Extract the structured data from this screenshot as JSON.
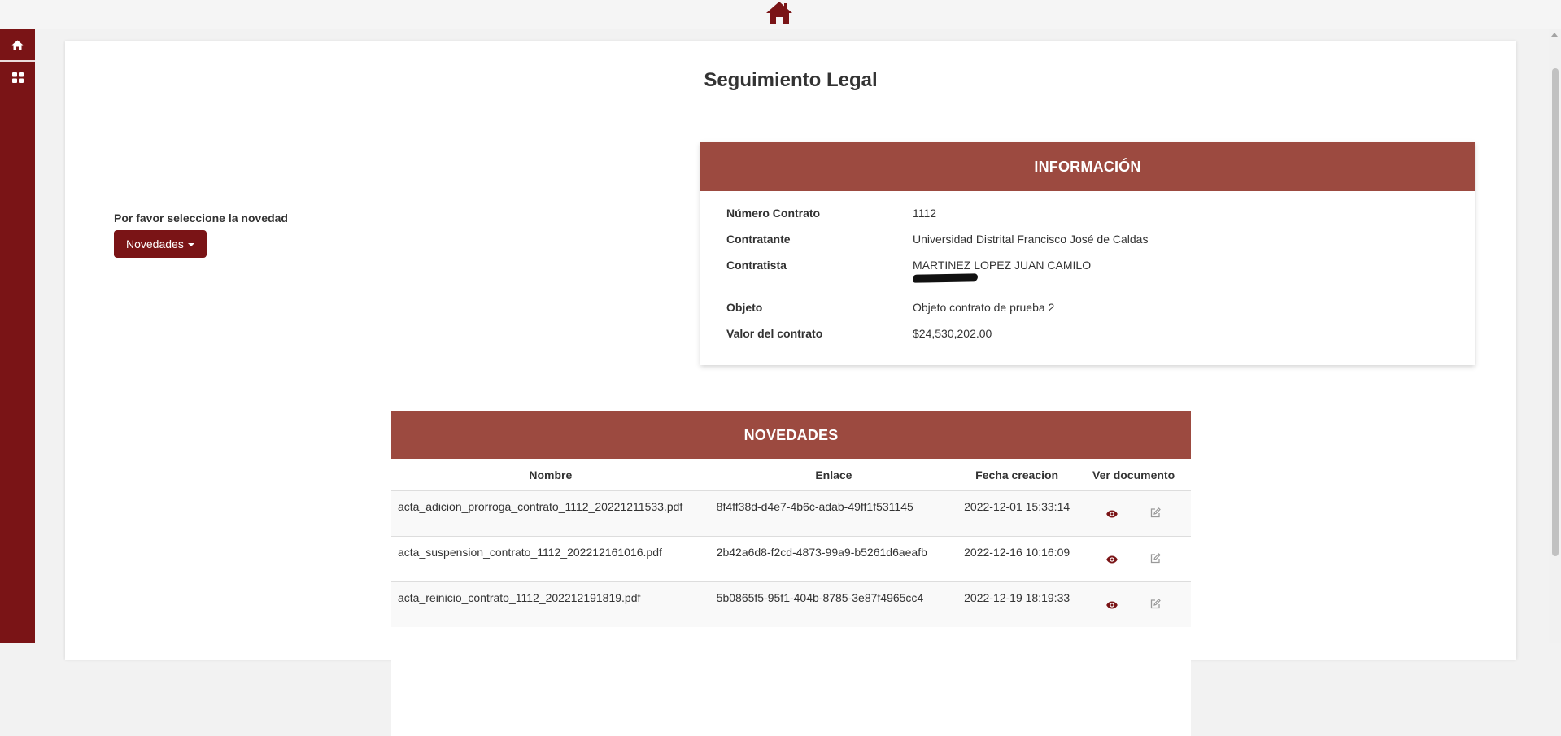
{
  "colors": {
    "brand": "#7a1416",
    "panel_header": "#9c4a40",
    "background": "#f2f2f2"
  },
  "topbar": {
    "home_icon": "home-icon"
  },
  "sidebar": {
    "items": [
      {
        "icon": "home-icon"
      },
      {
        "icon": "grid-icon"
      }
    ]
  },
  "page": {
    "title": "Seguimiento Legal",
    "prompt": "Por favor seleccione la novedad",
    "novedades_button": "Novedades"
  },
  "info": {
    "header": "INFORMACIÓN",
    "rows": [
      {
        "label": "Número Contrato",
        "value": "1112"
      },
      {
        "label": "Contratante",
        "value": "Universidad Distrital Francisco José de Caldas"
      },
      {
        "label": "Contratista",
        "value": "MARTINEZ LOPEZ JUAN CAMILO"
      },
      {
        "label": "Objeto",
        "value": "Objeto contrato de prueba 2"
      },
      {
        "label": "Valor del contrato",
        "value": "$24,530,202.00"
      }
    ]
  },
  "novedades": {
    "header": "NOVEDADES",
    "columns": [
      "Nombre",
      "Enlace",
      "Fecha creacion",
      "Ver documento"
    ],
    "rows": [
      {
        "nombre": "acta_adicion_prorroga_contrato_1112_20221211533.pdf",
        "enlace": "8f4ff38d-d4e7-4b6c-adab-49ff1f531145",
        "fecha": "2022-12-01 15:33:14"
      },
      {
        "nombre": "acta_suspension_contrato_1112_202212161016.pdf",
        "enlace": "2b42a6d8-f2cd-4873-99a9-b5261d6aeafb",
        "fecha": "2022-12-16 10:16:09"
      },
      {
        "nombre": "acta_reinicio_contrato_1112_202212191819.pdf",
        "enlace": "5b0865f5-95f1-404b-8785-3e87f4965cc4",
        "fecha": "2022-12-19 18:19:33"
      }
    ],
    "action_icons": [
      "eye-icon",
      "edit-icon"
    ]
  }
}
